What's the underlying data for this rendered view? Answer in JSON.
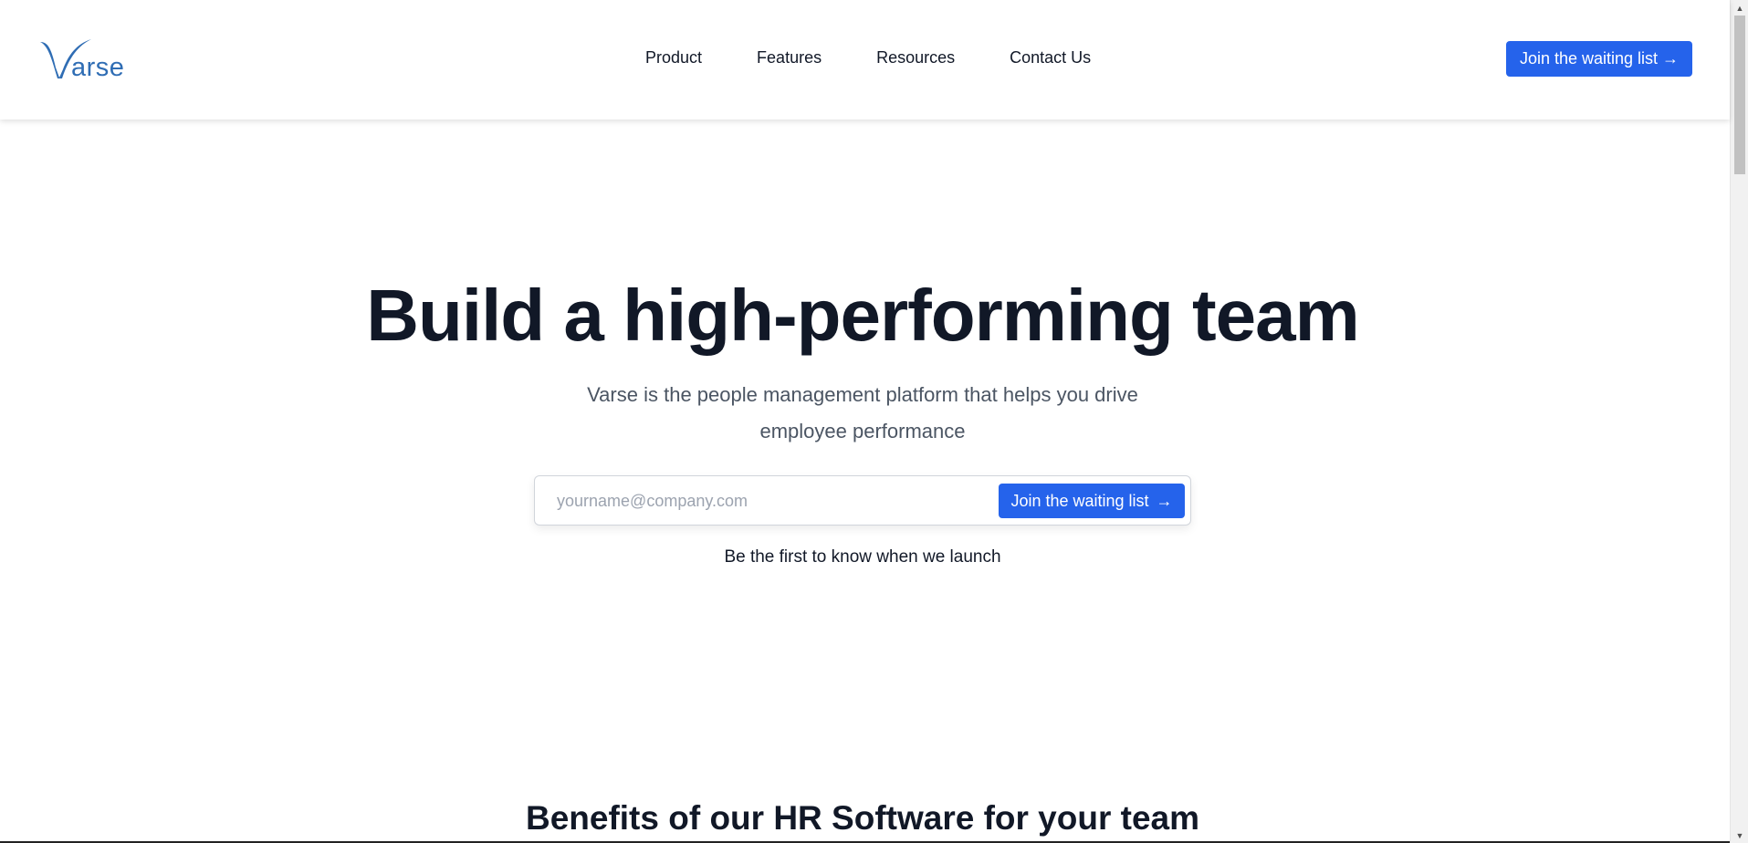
{
  "brand": {
    "logo_text": "arse",
    "logo_color": "#2f6db4"
  },
  "nav": {
    "items": [
      {
        "label": "Product"
      },
      {
        "label": "Features"
      },
      {
        "label": "Resources"
      },
      {
        "label": "Contact Us"
      }
    ]
  },
  "header": {
    "cta_label": "Join the waiting list →"
  },
  "hero": {
    "title": "Build a high-performing team",
    "subtitle": "Varse is the people management platform that helps you drive employee performance",
    "email_placeholder": "yourname@company.com",
    "email_value": "",
    "signup_label": "Join the waiting list",
    "signup_arrow": "→",
    "note": "Be the first to know when we launch"
  },
  "benefits": {
    "title": "Benefits of our HR Software for your team"
  },
  "colors": {
    "accent": "#2563eb",
    "heading": "#111827",
    "muted": "#4b5563"
  },
  "scrollbar": {
    "up_icon": "triangle-up-icon",
    "down_icon": "triangle-down-icon"
  }
}
